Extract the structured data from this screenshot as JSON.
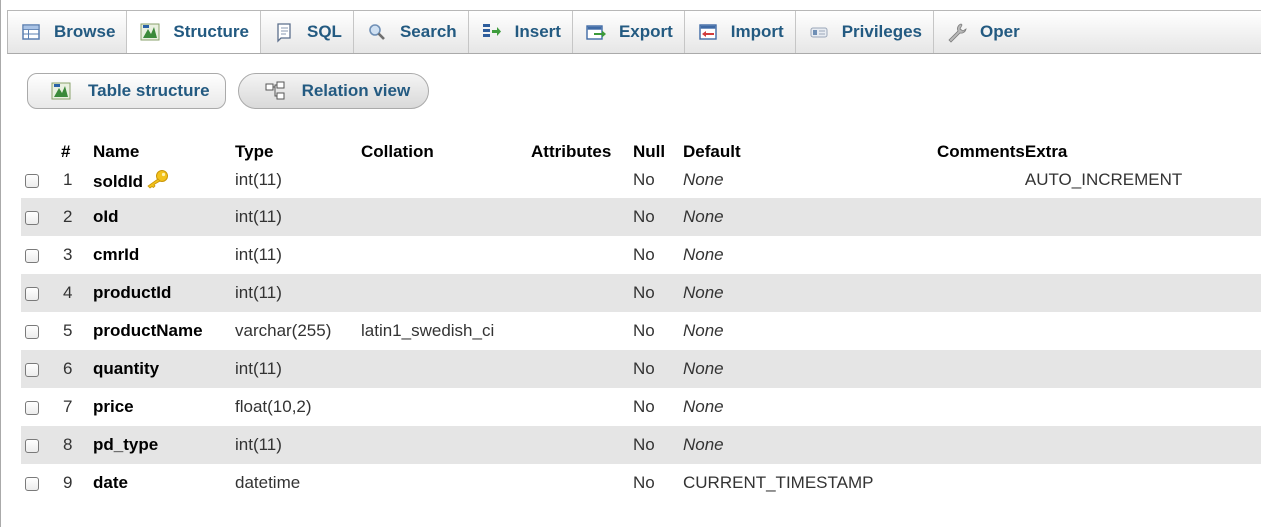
{
  "tabs": [
    {
      "label": "Browse",
      "icon": "browse-icon"
    },
    {
      "label": "Structure",
      "icon": "structure-icon",
      "active": true
    },
    {
      "label": "SQL",
      "icon": "sql-icon"
    },
    {
      "label": "Search",
      "icon": "search-icon"
    },
    {
      "label": "Insert",
      "icon": "insert-icon"
    },
    {
      "label": "Export",
      "icon": "export-icon"
    },
    {
      "label": "Import",
      "icon": "import-icon"
    },
    {
      "label": "Privileges",
      "icon": "privileges-icon"
    },
    {
      "label": "Oper",
      "icon": "operations-icon"
    }
  ],
  "subnav": {
    "table_structure": "Table structure",
    "relation_view": "Relation view"
  },
  "table": {
    "headers": {
      "num": "#",
      "name": "Name",
      "type": "Type",
      "collation": "Collation",
      "attributes": "Attributes",
      "null": "Null",
      "default": "Default",
      "comments": "Comments",
      "extra": "Extra"
    },
    "rows": [
      {
        "num": "1",
        "name": "soldId",
        "primary_key": true,
        "type": "int(11)",
        "collation": "",
        "attributes": "",
        "null": "No",
        "default": "None",
        "comments": "",
        "extra": "AUTO_INCREMENT"
      },
      {
        "num": "2",
        "name": "oId",
        "type": "int(11)",
        "collation": "",
        "attributes": "",
        "null": "No",
        "default": "None",
        "comments": "",
        "extra": ""
      },
      {
        "num": "3",
        "name": "cmrId",
        "type": "int(11)",
        "collation": "",
        "attributes": "",
        "null": "No",
        "default": "None",
        "comments": "",
        "extra": ""
      },
      {
        "num": "4",
        "name": "productId",
        "type": "int(11)",
        "collation": "",
        "attributes": "",
        "null": "No",
        "default": "None",
        "comments": "",
        "extra": ""
      },
      {
        "num": "5",
        "name": "productName",
        "type": "varchar(255)",
        "collation": "latin1_swedish_ci",
        "attributes": "",
        "null": "No",
        "default": "None",
        "comments": "",
        "extra": ""
      },
      {
        "num": "6",
        "name": "quantity",
        "type": "int(11)",
        "collation": "",
        "attributes": "",
        "null": "No",
        "default": "None",
        "comments": "",
        "extra": ""
      },
      {
        "num": "7",
        "name": "price",
        "type": "float(10,2)",
        "collation": "",
        "attributes": "",
        "null": "No",
        "default": "None",
        "comments": "",
        "extra": ""
      },
      {
        "num": "8",
        "name": "pd_type",
        "type": "int(11)",
        "collation": "",
        "attributes": "",
        "null": "No",
        "default": "None",
        "comments": "",
        "extra": ""
      },
      {
        "num": "9",
        "name": "date",
        "type": "datetime",
        "collation": "",
        "attributes": "",
        "null": "No",
        "default": "CURRENT_TIMESTAMP",
        "comments": "",
        "extra": ""
      }
    ]
  },
  "colors": {
    "link": "#235a81",
    "row_alt": "#e5e5e5",
    "key": "#f0b400"
  }
}
